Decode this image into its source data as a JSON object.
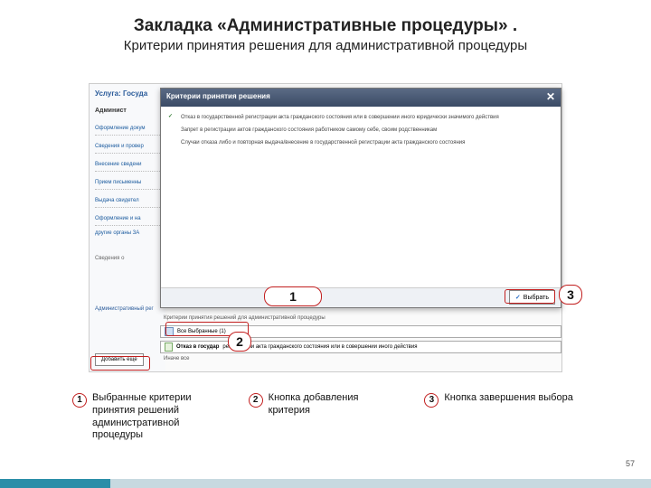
{
  "title": "Закладка «Административные процедуры» .",
  "subtitle": "Критерии принятия решения для административной процедуры",
  "page_number": "57",
  "screenshot": {
    "service_label": "Услуга: Госуда",
    "admin_label": "Админист",
    "nav": [
      "Оформление докум",
      "Сведения и провер",
      "Внесение сведени",
      "Прием письменны",
      "Выдача свидетел",
      "Оформление и на",
      "другие органы ЗА"
    ],
    "modal": {
      "title": "Критерии принятия решения",
      "items": [
        "Отказ в государственной регистрации акта гражданского состояния или в совершении иного юридически значимого действия",
        "Запрет в регистрации актов гражданского состояния работником самому себе, своим родственникам",
        "Случаи отказа либо и повторная выдача/внесение в государственной регистрации акта гражданского состояния"
      ],
      "close": "✕",
      "select_button": "Выбрать"
    },
    "lower": {
      "svedeniya": "Сведения о",
      "all_label": "Все Выбранные (1)",
      "criteria_label": "Критерии принятия решений для административной процедуры",
      "chosen_head": "Отказ в государ",
      "chosen_text": "регистрации акта гражданского состояния или в совершении иного действия",
      "all_sub": "Иначе все",
      "admin_reg": "Административный рег"
    },
    "add_button": "Добавить еще"
  },
  "callouts": {
    "c1": "1",
    "c2": "2",
    "c3": "3"
  },
  "legend": [
    {
      "num": "1",
      "text": "Выбранные критерии принятия решений административной процедуры"
    },
    {
      "num": "2",
      "text": "Кнопка добавления критерия"
    },
    {
      "num": "3",
      "text": "Кнопка завершения выбора"
    }
  ]
}
